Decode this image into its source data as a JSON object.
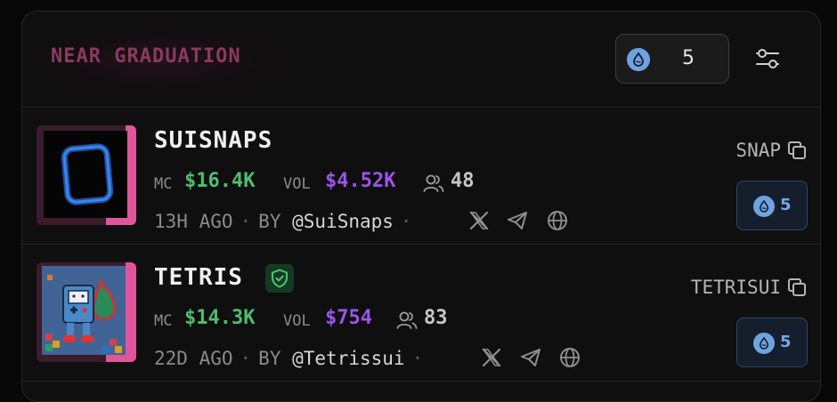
{
  "section": {
    "title": "NEAR GRADUATION",
    "amount_value": "5",
    "amount_icon": "sui-coin-icon",
    "filter_icon": "sliders-icon"
  },
  "tokens": [
    {
      "name": "SUISNAPS",
      "verified": false,
      "ticker": "SNAP",
      "mc_label": "MC",
      "mc_value": "$16.4K",
      "vol_label": "VOL",
      "vol_value": "$4.52K",
      "holders": "48",
      "age": "13H AGO",
      "by_label": "BY",
      "creator": "@SuiSnaps",
      "buy_amount": "5",
      "accent_color": "#e0559a"
    },
    {
      "name": "TETRIS",
      "verified": true,
      "ticker": "TETRISUI",
      "mc_label": "MC",
      "mc_value": "$14.3K",
      "vol_label": "VOL",
      "vol_value": "$754",
      "holders": "83",
      "age": "22D AGO",
      "by_label": "BY",
      "creator": "@Tetrissui",
      "buy_amount": "5",
      "accent_color": "#e0559a"
    }
  ],
  "colors": {
    "title": "#8a3a5e",
    "mc": "#4fbe6e",
    "vol": "#9b55e8",
    "buy_text": "#74a8e8",
    "sui_coin": "#6fa3df"
  }
}
